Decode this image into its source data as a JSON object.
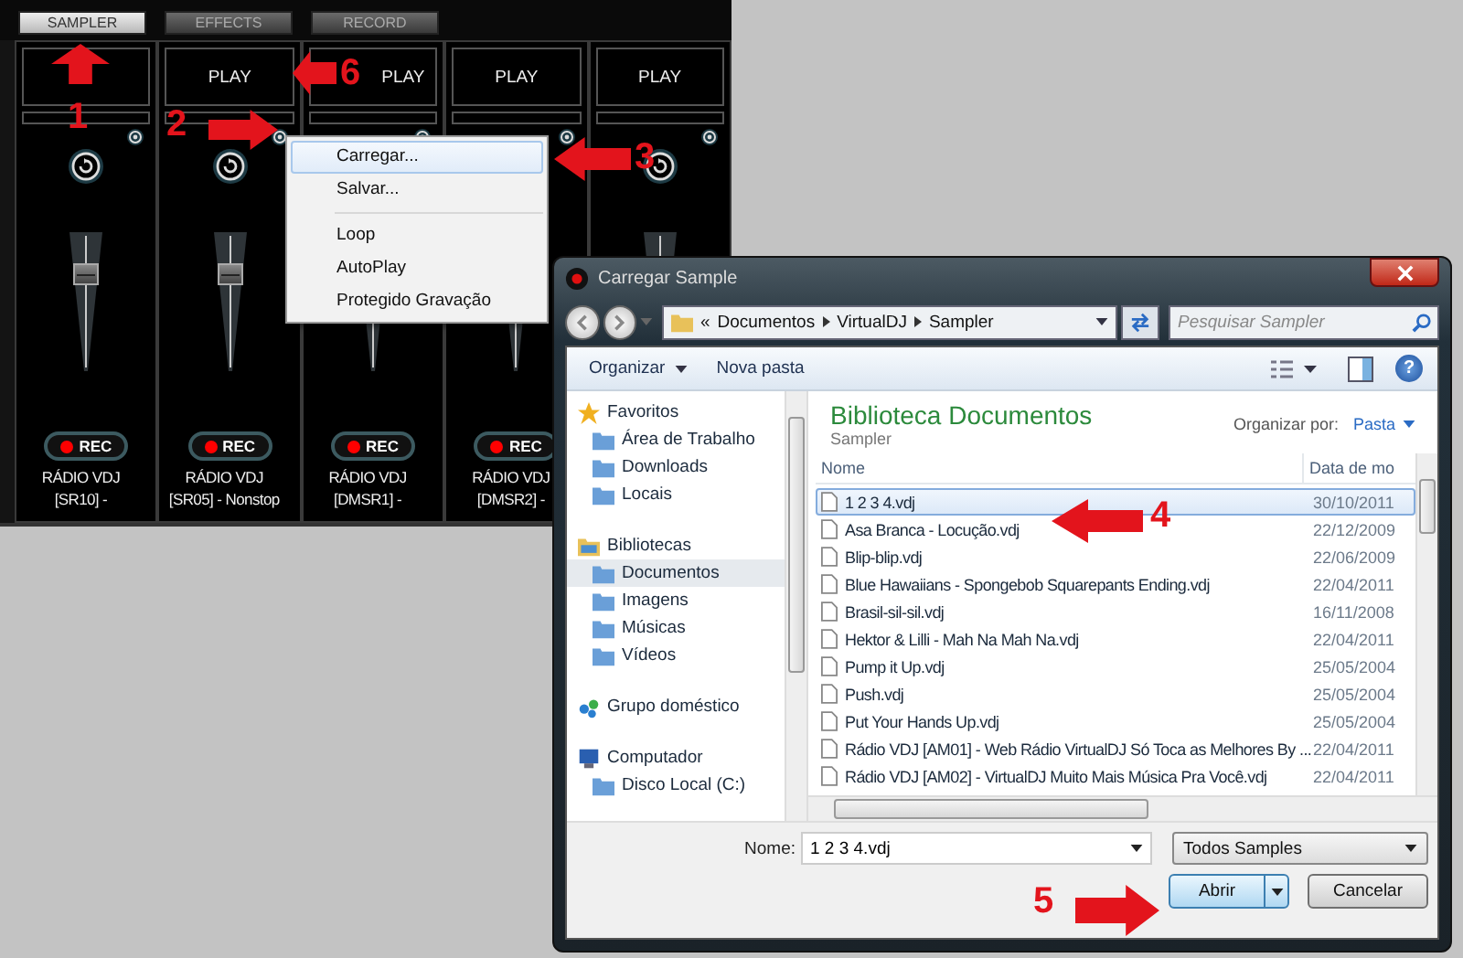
{
  "app": {
    "tabs": [
      {
        "label": "SAMPLER",
        "selected": true
      },
      {
        "label": "EFFECTS",
        "selected": false
      },
      {
        "label": "RECORD",
        "selected": false
      }
    ],
    "samplers": [
      {
        "rec": "REC",
        "name": [
          "RÁDIO VDJ",
          "[SR10] -"
        ],
        "level": 0.72
      },
      {
        "play": "PLAY",
        "rec": "REC",
        "name": [
          "RÁDIO VDJ",
          "[SR05] - Nonstop"
        ],
        "level": 0.72
      },
      {
        "play": "PLAY",
        "rec": "REC",
        "name": [
          "RÁDIO VDJ",
          "[DMSR1] -"
        ]
      },
      {
        "play": "PLAY",
        "rec": "REC",
        "name": [
          "RÁDIO VDJ",
          "[DMSR2] -"
        ]
      },
      {
        "play": "PLAY"
      }
    ]
  },
  "context_menu": {
    "items": [
      {
        "kind": "item",
        "label": "Carregar...",
        "selected": true
      },
      {
        "kind": "item",
        "label": "Salvar...",
        "selected": false
      },
      {
        "kind": "separator"
      },
      {
        "kind": "item",
        "label": "Loop",
        "selected": false
      },
      {
        "kind": "item",
        "label": "AutoPlay",
        "selected": false
      },
      {
        "kind": "item",
        "label": "Protegido Gravação",
        "selected": false
      }
    ]
  },
  "dialog": {
    "title": "Carregar Sample",
    "breadcrumb_prefix": "«",
    "breadcrumb": [
      "Documentos",
      "VirtualDJ",
      "Sampler"
    ],
    "search": {
      "placeholder": "Pesquisar Sampler"
    },
    "toolbar": [
      "Organizar",
      "Nova pasta"
    ],
    "help": "?",
    "nav": [
      {
        "label": "Favoritos",
        "children": [
          {
            "label": "Área de Trabalho",
            "selected": false
          },
          {
            "label": "Downloads",
            "selected": false
          },
          {
            "label": "Locais",
            "selected": false
          }
        ]
      },
      {
        "label": "Bibliotecas",
        "children": [
          {
            "label": "Documentos",
            "selected": true
          },
          {
            "label": "Imagens",
            "selected": false
          },
          {
            "label": "Músicas",
            "selected": false
          },
          {
            "label": "Vídeos",
            "selected": false
          }
        ]
      },
      {
        "label": "Grupo doméstico"
      },
      {
        "label": "Computador",
        "children": [
          {
            "label": "Disco Local (C:)",
            "selected": false
          }
        ]
      }
    ],
    "library": {
      "title": "Biblioteca Documentos",
      "subtitle": "Sampler",
      "arrange_label": "Organizar por:",
      "arrange_value": "Pasta"
    },
    "columns": [
      "Nome",
      "Data de mo"
    ],
    "files": [
      {
        "name": "1 2 3 4.vdj",
        "date": "30/10/2011",
        "selected": true
      },
      {
        "name": "Asa Branca - Locução.vdj",
        "date": "22/12/2009",
        "selected": false
      },
      {
        "name": "Blip-blip.vdj",
        "date": "22/06/2009",
        "selected": false
      },
      {
        "name": "Blue Hawaiians - Spongebob Squarepants Ending.vdj",
        "date": "22/04/2011",
        "selected": false
      },
      {
        "name": "Brasil-sil-sil.vdj",
        "date": "16/11/2008",
        "selected": false
      },
      {
        "name": "Hektor & Lilli - Mah Na Mah Na.vdj",
        "date": "22/04/2011",
        "selected": false
      },
      {
        "name": "Pump it Up.vdj",
        "date": "25/05/2004",
        "selected": false
      },
      {
        "name": "Push.vdj",
        "date": "25/05/2004",
        "selected": false
      },
      {
        "name": "Put Your Hands Up.vdj",
        "date": "25/05/2004",
        "selected": false
      },
      {
        "name": "Rádio VDJ [AM01] - Web Rádio VirtualDJ Só Toca as Melhores By ...",
        "date": "22/04/2011",
        "selected": false
      },
      {
        "name": "Rádio VDJ [AM02] - VirtualDJ Muito Mais Música Pra Você.vdj",
        "date": "22/04/2011",
        "selected": false
      }
    ],
    "footer": {
      "name_label": "Nome:",
      "name_value": "1 2 3 4.vdj",
      "filter": "Todos Samples",
      "open": "Abrir",
      "cancel": "Cancelar"
    }
  },
  "annotations": [
    {
      "label": "1",
      "kind": "up"
    },
    {
      "label": "2",
      "kind": "right"
    },
    {
      "label": "3",
      "kind": "left"
    },
    {
      "label": "4",
      "kind": "left"
    },
    {
      "label": "5",
      "kind": "right"
    },
    {
      "label": "6",
      "kind": "left"
    }
  ]
}
